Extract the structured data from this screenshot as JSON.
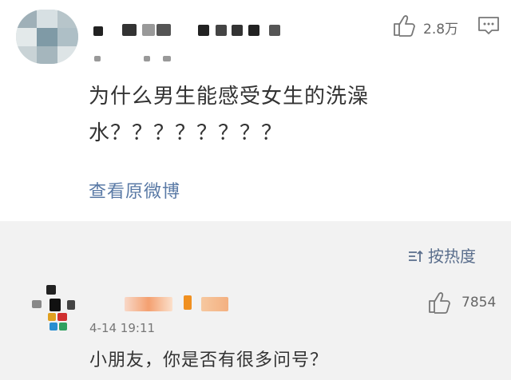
{
  "post": {
    "likes": "2.8万",
    "text_line1": "为什么男生能感受女生的洗澡",
    "text_line2": "水？？？？？？？？",
    "view_original": "查看原微博"
  },
  "sort": {
    "label": "按热度"
  },
  "comment": {
    "time": "4-14 19:11",
    "text": "小朋友，你是否有很多问号？",
    "likes": "7854"
  },
  "colors": {
    "link": "#5a7aa6",
    "background": "#f2f2f2",
    "card": "#ffffff"
  }
}
